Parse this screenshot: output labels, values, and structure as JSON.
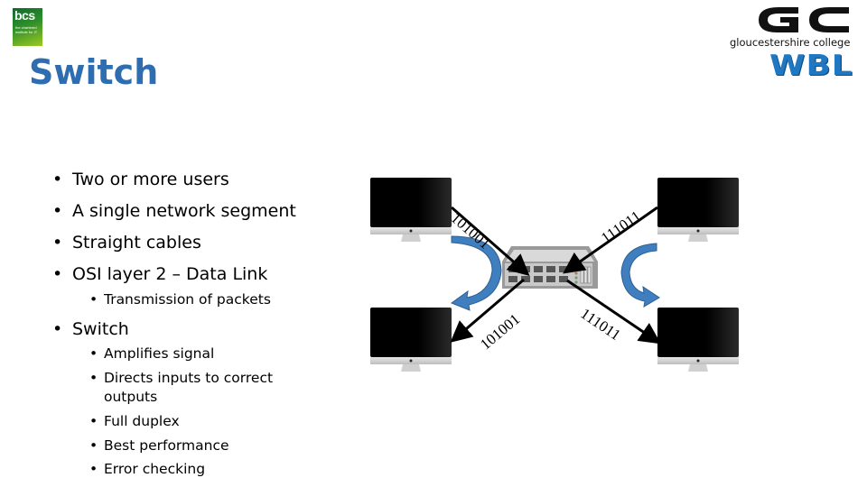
{
  "logos": {
    "bcs": {
      "main": "bcs",
      "tagline": "the chartered institute for IT"
    },
    "college": {
      "mark": "GC",
      "name": "gloucestershire college",
      "unit": "WBL"
    }
  },
  "title": "Switch",
  "bullets": [
    {
      "text": "Two or more users",
      "level": 1
    },
    {
      "text": "A single network segment",
      "level": 1
    },
    {
      "text": "Straight cables",
      "level": 1
    },
    {
      "text": "OSI layer 2 – Data Link",
      "level": 1
    },
    {
      "text": "Transmission of packets",
      "level": 2
    },
    {
      "text": "Switch",
      "level": 1
    },
    {
      "text": "Amplifies signal",
      "level": 2
    },
    {
      "text": "Directs inputs to correct",
      "continuation": "outputs",
      "level": 2
    },
    {
      "text": "Full duplex",
      "level": 2
    },
    {
      "text": "Best performance",
      "level": 2
    },
    {
      "text": "Error checking",
      "level": 2
    }
  ],
  "bullet_glyph": "•",
  "diagram": {
    "device": "network switch",
    "computers": [
      "top-left",
      "top-right",
      "bottom-left",
      "bottom-right"
    ],
    "links": [
      {
        "from": "top-left computer",
        "to": "switch",
        "bits": "101001"
      },
      {
        "from": "top-right computer",
        "to": "switch",
        "bits": "111011"
      },
      {
        "from": "switch",
        "to": "bottom-left computer",
        "bits": "101001"
      },
      {
        "from": "switch",
        "to": "bottom-right computer",
        "bits": "111011"
      }
    ],
    "colors": {
      "arrow_curve": "#3f7fbf",
      "screen": "#000000",
      "switch_body": "#c8c8c8"
    }
  }
}
